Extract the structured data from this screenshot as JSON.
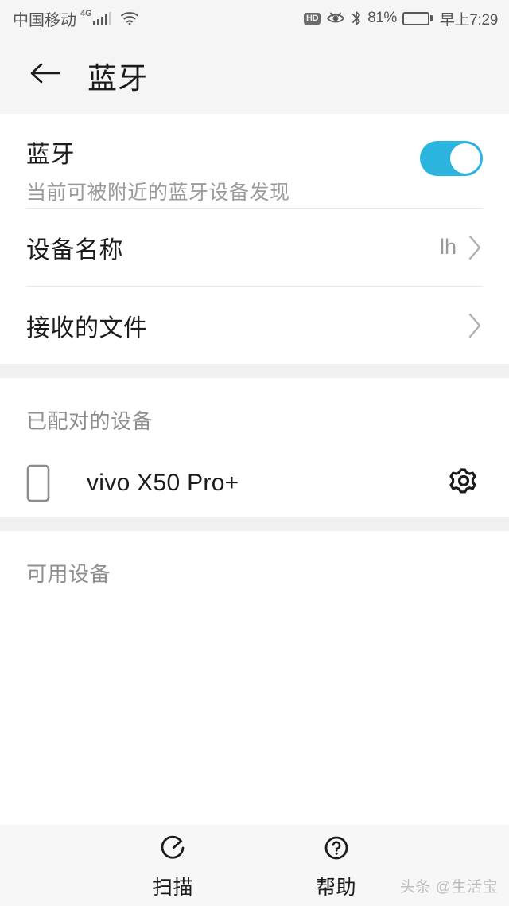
{
  "status_bar": {
    "carrier": "中国移动",
    "network_type": "4G",
    "signal_bars": 4,
    "wifi_icon": "wifi-icon",
    "hd_label": "HD",
    "eye_comfort_icon": "eye-icon",
    "bluetooth_icon": "bluetooth-icon",
    "battery_percent": "81%",
    "battery_level": 81,
    "time": "早上7:29"
  },
  "header": {
    "back_icon": "arrow-left-icon",
    "title": "蓝牙"
  },
  "bluetooth": {
    "title": "蓝牙",
    "subtitle": "当前可被附近的蓝牙设备发现",
    "enabled": true,
    "toggle_color": "#2AB4DE"
  },
  "device_name": {
    "label": "设备名称",
    "value": "lh",
    "chevron_icon": "chevron-right-icon"
  },
  "received_files": {
    "label": "接收的文件",
    "chevron_icon": "chevron-right-icon"
  },
  "paired_section": {
    "label": "已配对的设备",
    "devices": [
      {
        "name": "vivo X50 Pro+",
        "type_icon": "phone-icon",
        "settings_icon": "gear-icon"
      }
    ]
  },
  "available_section": {
    "label": "可用设备",
    "devices": []
  },
  "bottom_bar": {
    "buttons": [
      {
        "label": "扫描",
        "icon": "scan-refresh-icon"
      },
      {
        "label": "帮助",
        "icon": "question-circle-icon"
      }
    ]
  },
  "watermark": {
    "text": "头条 @生活宝"
  }
}
